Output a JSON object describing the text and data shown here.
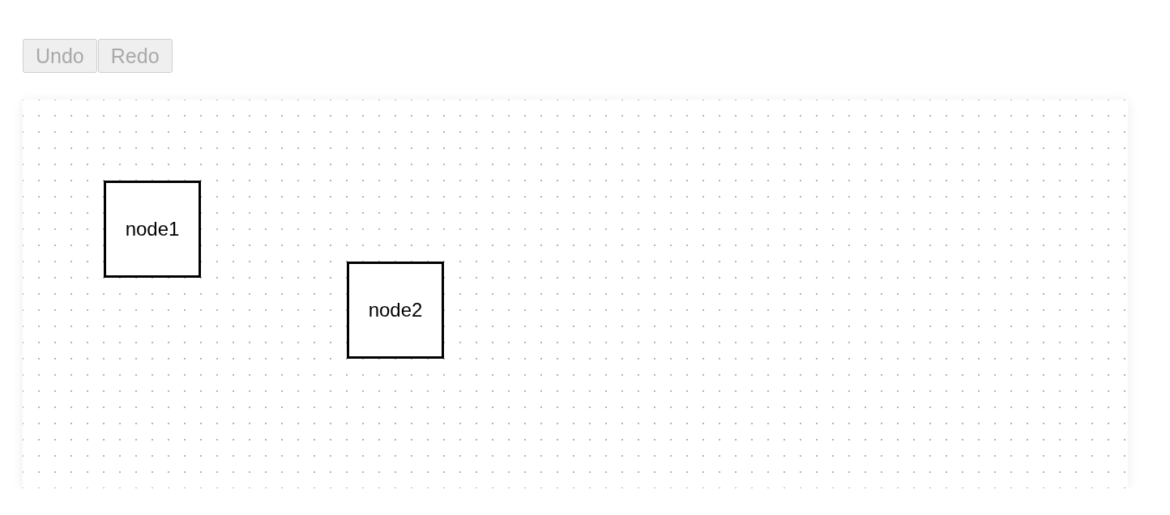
{
  "toolbar": {
    "buttons": [
      {
        "label": "Undo",
        "disabled": true
      },
      {
        "label": "Redo",
        "disabled": true
      }
    ]
  },
  "canvas": {
    "nodes": [
      {
        "label": "node1"
      },
      {
        "label": "node2"
      }
    ]
  }
}
